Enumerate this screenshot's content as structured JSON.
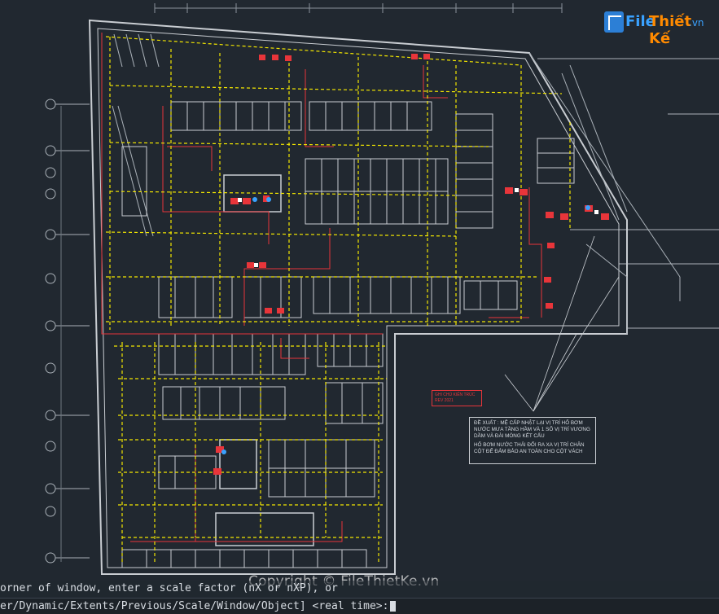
{
  "logo": {
    "part1": "File",
    "part2": "Thiết Kế",
    "part3": ".vn"
  },
  "watermark": {
    "text": "Copyright © FileThietKe.vn"
  },
  "annotation": {
    "line1": "ĐỀ XUẤT : MỆ CẤP NHẬT LẠI VỊ TRÍ HỐ BƠM NƯỚC MƯA TẦNG HẦM VÀ 1 SỐ VỊ TRÍ VƯƠNG DẦM VÀ ĐÀI MÓNG KẾT CẤU",
    "line2": "HỐ BƠM NƯỚC THẢI ĐỔI RA XA VỊ TRÍ CHÂN CỘT ĐỂ ĐẢM BẢO AN TOÀN CHO CỘT VÁCH"
  },
  "red_note": {
    "line1": "GHI CHÚ KIẾN TRÚC",
    "line2": "REV 2021"
  },
  "command_line": {
    "history": "orner of window, enter a scale factor (nX or nXP), or",
    "prompt": "er/Dynamic/Extents/Previous/Scale/Window/Object] <real time>:"
  },
  "colors": {
    "background": "#212830",
    "outline": "#c9cdd2",
    "wiring": "#f2e600",
    "circuit": "#e8353a",
    "accent": "#3aa2ff"
  }
}
